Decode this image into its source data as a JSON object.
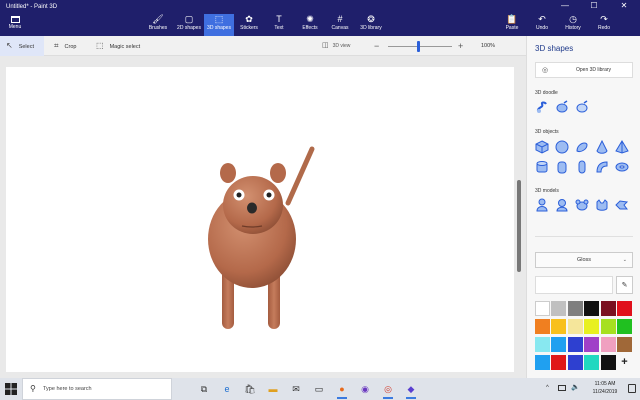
{
  "window": {
    "title": "Untitled* - Paint 3D",
    "menu_label": "Menu",
    "controls": {
      "minimize": "—",
      "maximize": "☐",
      "close": "✕"
    }
  },
  "ribbon": {
    "tools": [
      {
        "label": "Brushes",
        "icon": "paintbrush-icon",
        "glyph": "🖌"
      },
      {
        "label": "2D shapes",
        "icon": "2d-shapes-icon",
        "glyph": "▢"
      },
      {
        "label": "3D shapes",
        "icon": "3d-shapes-icon",
        "glyph": "⬚"
      },
      {
        "label": "Stickers",
        "icon": "stickers-icon",
        "glyph": "✿"
      },
      {
        "label": "Text",
        "icon": "text-icon",
        "glyph": "T"
      },
      {
        "label": "Effects",
        "icon": "effects-icon",
        "glyph": "✺"
      },
      {
        "label": "Canvas",
        "icon": "canvas-icon",
        "glyph": "#"
      },
      {
        "label": "3D library",
        "icon": "3d-library-icon",
        "glyph": "❂"
      }
    ],
    "active_tool": "3D shapes",
    "right_tools": [
      {
        "label": "Paste",
        "icon": "paste-icon",
        "glyph": "📋"
      },
      {
        "label": "Undo",
        "icon": "undo-icon",
        "glyph": "↶"
      },
      {
        "label": "History",
        "icon": "history-icon",
        "glyph": "◷"
      },
      {
        "label": "Redo",
        "icon": "redo-icon",
        "glyph": "↷"
      }
    ]
  },
  "canvas_toolbar": {
    "select_label": "Select",
    "crop_label": "Crop",
    "magic_select_label": "Magic select",
    "view_3d_label": "3D view",
    "zoom_minus": "−",
    "zoom_plus": "+",
    "zoom_value": "100%",
    "zoom_fraction": 0.48
  },
  "side_panel": {
    "title": "3D shapes",
    "open_library_label": "Open 3D library",
    "doodle_label": "3D doodle",
    "objects_label": "3D objects",
    "models_label": "3D models",
    "doodles": [
      "sharp-edge-doodle-icon",
      "soft-edge-doodle-icon",
      "tube-doodle-icon"
    ],
    "objects": [
      "cube-icon",
      "sphere-icon",
      "hemisphere-icon",
      "cone-icon",
      "pyramid-icon",
      "cylinder-icon",
      "tube-icon",
      "capsule-icon",
      "donut-icon",
      "torus-icon"
    ],
    "models": [
      "man-model-icon",
      "woman-model-icon",
      "dog-model-icon",
      "cat-model-icon",
      "fish-model-icon"
    ],
    "material_label": "Gloss",
    "eyedropper_icon": "eyedropper-icon",
    "palette": [
      "#ffffff",
      "#c0c0c0",
      "#7f7f7f",
      "#111111",
      "#7a1020",
      "#e0101c",
      "#f07f20",
      "#f8c01c",
      "#f5e69b",
      "#e8f020",
      "#a6e020",
      "#20c020",
      "#88e8f0",
      "#20a0f0",
      "#2e40d0",
      "#a040c8",
      "#f0a0c0",
      "#a06838",
      "#20a0f0",
      "#e01818",
      "#2e40d0",
      "#20d8c0",
      "#111111"
    ],
    "add_color_label": "+"
  },
  "taskbar": {
    "search_placeholder": "Type here to search",
    "apps": [
      {
        "name": "task-view-icon",
        "glyph": "⧉",
        "color": "#333333",
        "running": false
      },
      {
        "name": "edge-icon",
        "glyph": "e",
        "color": "#1f6fd0",
        "running": false
      },
      {
        "name": "store-icon",
        "glyph": "🛍",
        "color": "#444444",
        "running": false
      },
      {
        "name": "file-explorer-icon",
        "glyph": "▬",
        "color": "#e0a020",
        "running": false
      },
      {
        "name": "mail-icon",
        "glyph": "✉",
        "color": "#333333",
        "running": false
      },
      {
        "name": "terminal-icon",
        "glyph": "▭",
        "color": "#222222",
        "running": false
      },
      {
        "name": "firefox-icon",
        "glyph": "●",
        "color": "#e76a1c",
        "running": true
      },
      {
        "name": "media-player-icon",
        "glyph": "◉",
        "color": "#6a38c0",
        "running": false
      },
      {
        "name": "chrome-icon",
        "glyph": "◎",
        "color": "#d03a2a",
        "running": true
      },
      {
        "name": "paint3d-icon",
        "glyph": "◆",
        "color": "#5a3fd0",
        "running": true
      }
    ],
    "tray_up": "^",
    "time": "11:05 AM",
    "date": "11/24/2019"
  }
}
